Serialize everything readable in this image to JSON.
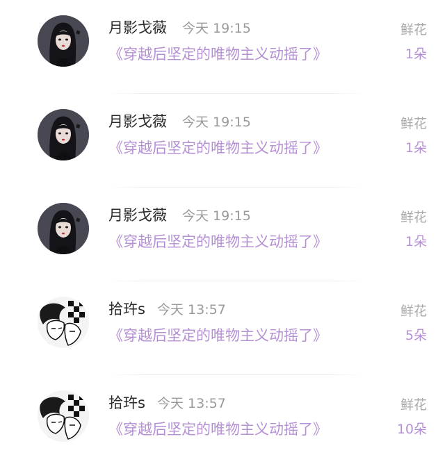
{
  "records": [
    {
      "username": "月影戈薇",
      "time": "今天 19:15",
      "book_title": "《穿越后坚定的唯物主义动摇了》",
      "gift_label": "鲜花",
      "gift_count": "1朵",
      "avatar": "girl-avatar"
    },
    {
      "username": "月影戈薇",
      "time": "今天 19:15",
      "book_title": "《穿越后坚定的唯物主义动摇了》",
      "gift_label": "鲜花",
      "gift_count": "1朵",
      "avatar": "girl-avatar"
    },
    {
      "username": "月影戈薇",
      "time": "今天 19:15",
      "book_title": "《穿越后坚定的唯物主义动摇了》",
      "gift_label": "鲜花",
      "gift_count": "1朵",
      "avatar": "girl-avatar"
    },
    {
      "username": "拾玝s",
      "time": "今天 13:57",
      "book_title": "《穿越后坚定的唯物主义动摇了》",
      "gift_label": "鲜花",
      "gift_count": "5朵",
      "avatar": "manga-avatar"
    },
    {
      "username": "拾玝s",
      "time": "今天 13:57",
      "book_title": "《穿越后坚定的唯物主义动摇了》",
      "gift_label": "鲜花",
      "gift_count": "10朵",
      "avatar": "manga-avatar"
    }
  ]
}
